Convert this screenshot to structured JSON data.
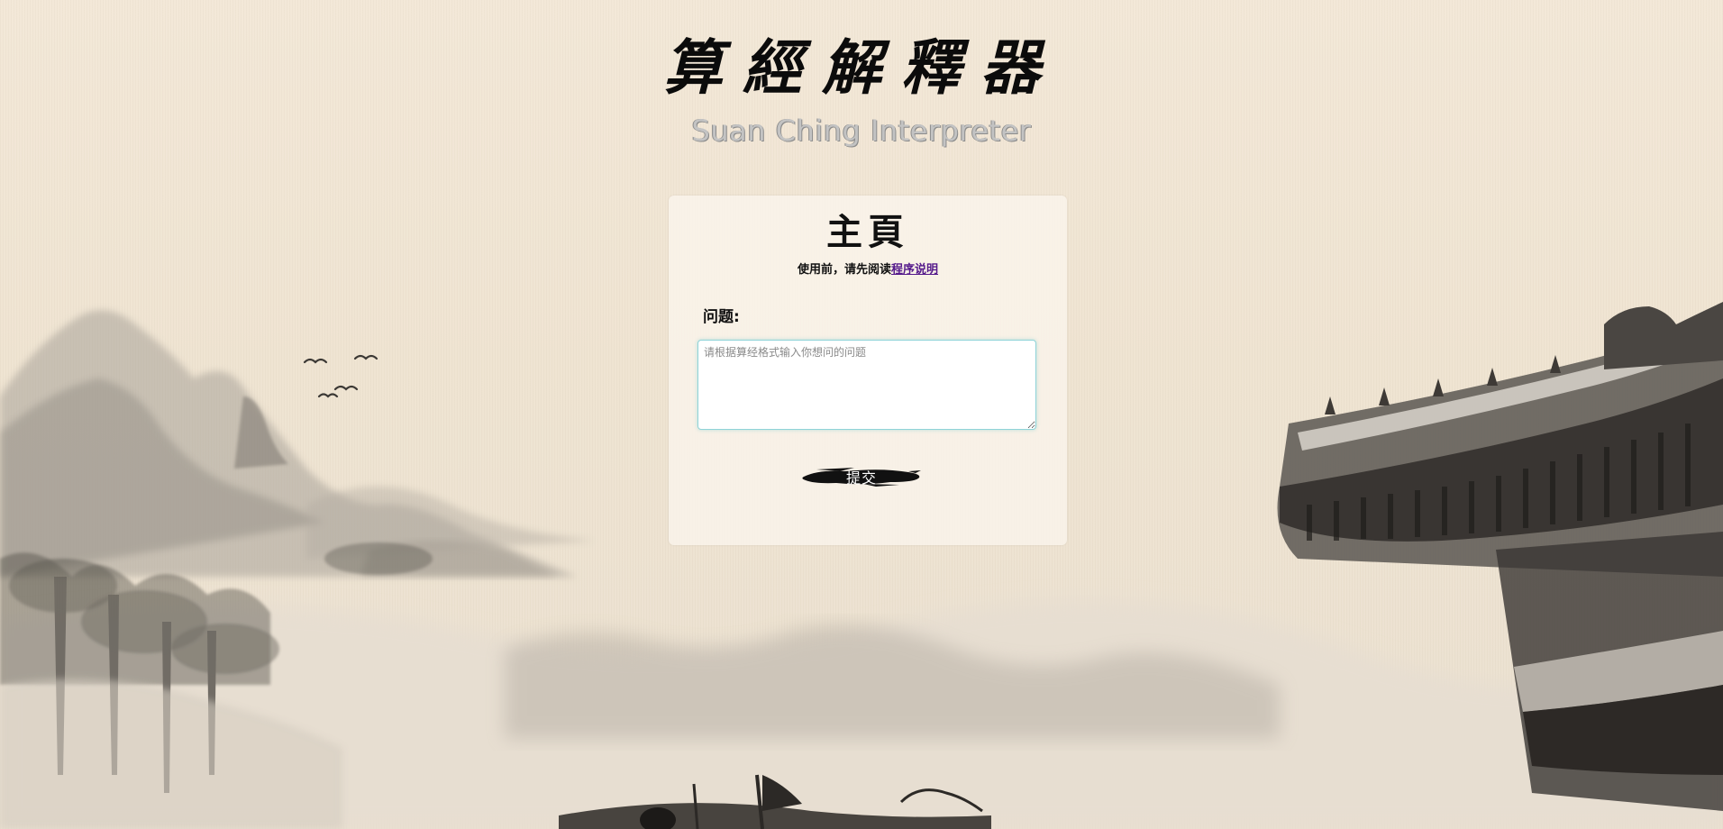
{
  "header": {
    "title": "算經解釋器",
    "subtitle": "Suan Ching Interpreter"
  },
  "card": {
    "title": "主頁",
    "notice_prefix": "使用前，请先阅读",
    "notice_link": "程序说明",
    "question_label": "问题:",
    "question_value": "",
    "question_placeholder": "请根据算经格式输入你想问的问题",
    "submit_label": "提交"
  },
  "colors": {
    "background": "#efe3d1",
    "card": "#faf4ec",
    "link": "#551a8b",
    "input_border": "#8fd3d8",
    "ink": "#111111"
  },
  "decorations": {
    "background_image": "ink-wash-landscape",
    "left_scene": "mountains-and-trees",
    "right_scene": "pagoda-roof",
    "bottom_scene": "boat",
    "birds": "flying-birds"
  }
}
